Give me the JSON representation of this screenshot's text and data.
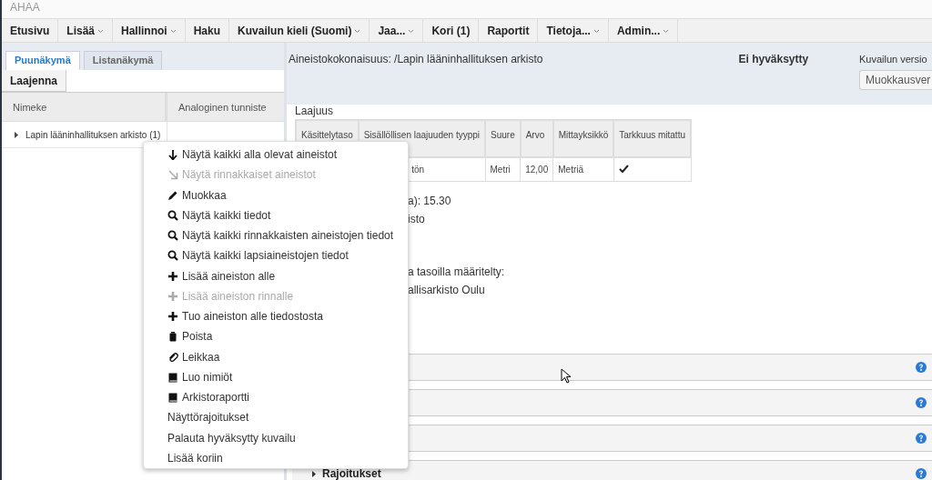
{
  "app": {
    "title": "AHAA"
  },
  "nav": [
    {
      "label": "Etusivu",
      "dropdown": false
    },
    {
      "label": "Lisää",
      "dropdown": true
    },
    {
      "label": "Hallinnoi",
      "dropdown": true
    },
    {
      "label": "Haku",
      "dropdown": false
    },
    {
      "label": "Kuvailun kieli (Suomi)",
      "dropdown": true
    },
    {
      "label": "Jaa...",
      "dropdown": true
    },
    {
      "label": "Kori (1)",
      "dropdown": false
    },
    {
      "label": "Raportit",
      "dropdown": false
    },
    {
      "label": "Tietoja...",
      "dropdown": true
    },
    {
      "label": "Admin...",
      "dropdown": true
    }
  ],
  "left": {
    "tabs": [
      {
        "label": "Puunäkymä",
        "selected": true
      },
      {
        "label": "Listanäkymä",
        "selected": false
      }
    ],
    "expand_button": "Laajenna",
    "columns": [
      "Nimeke",
      "Analoginen tunniste"
    ],
    "tree": [
      {
        "label": "Lapin lääninhallituksen arkisto (1)",
        "expanded": false
      }
    ]
  },
  "detail": {
    "path": "Aineistokokonaisuus: /Lapin lääninhallituksen arkisto",
    "status": "Ei hyväksytty",
    "version_label": "Kuvailun versio",
    "version_value": "Muokkausver",
    "extent_title": "Laajuus",
    "extent_table": {
      "columns": [
        "Käsittelytaso",
        "Sisällöllisen laajuuden tyyppi",
        "Suure",
        "Arvo",
        "Mittayksikkö",
        "Tarkkuus mitattu"
      ],
      "rows": [
        {
          "cells": [
            "",
            "tön",
            "Metri",
            "12,00",
            "Metriä"
          ],
          "measured": true
        }
      ]
    },
    "line_groups": [
      [
        "a): 15.30",
        "isto"
      ],
      [
        "a tasoilla määritelty:",
        "allisarkisto Oulu"
      ]
    ],
    "sections": [
      {
        "kind": "section"
      },
      {
        "kind": "section"
      },
      {
        "kind": "section"
      },
      {
        "kind": "section",
        "title": "Rajoitukset",
        "expanded": false
      }
    ]
  },
  "context_menu": [
    {
      "label": "Näytä kaikki alla olevat aineistot",
      "disabled": false
    },
    {
      "label": "Näytä rinnakkaiset aineistot",
      "disabled": true
    },
    {
      "label": "Muokkaa",
      "disabled": false
    },
    {
      "label": "Näytä kaikki tiedot",
      "disabled": false
    },
    {
      "label": "Näytä kaikki rinnakkaisten aineistojen tiedot",
      "disabled": false
    },
    {
      "label": "Näytä kaikki lapsiaineistojen tiedot",
      "disabled": false
    },
    {
      "label": "Lisää aineiston alle",
      "disabled": false
    },
    {
      "label": "Lisää aineiston rinnalle",
      "disabled": true
    },
    {
      "label": "Tuo aineiston alle tiedostosta",
      "disabled": false
    },
    {
      "label": "Poista",
      "disabled": false
    },
    {
      "label": "Leikkaa",
      "disabled": false
    },
    {
      "label": "Luo nimiöt",
      "disabled": false
    },
    {
      "label": "Arkistoraportti",
      "disabled": false
    },
    {
      "label": "Näyttörajoitukset",
      "disabled": false
    },
    {
      "label": "Palauta hyväksytty kuvailu",
      "disabled": false
    },
    {
      "label": "Lisää koriin",
      "disabled": false
    }
  ]
}
